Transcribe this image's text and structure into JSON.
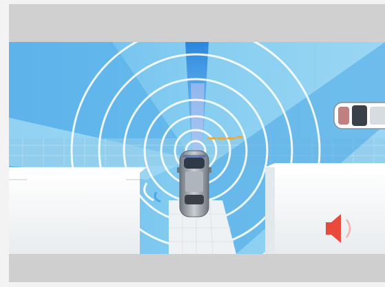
{
  "scene": {
    "description_label": "",
    "colors": {
      "sky_blue": "#7fc8ef",
      "deep_blue": "#4aa8e6",
      "beam_blue": "#2f8ee0",
      "ring_white": "#ffffff",
      "wall_white": "#f4f6f8",
      "road_light": "#e9f3f8",
      "car_gray": "#8e959d",
      "car_dark": "#3a4048",
      "orange_signal": "#f5a623",
      "speaker_red": "#e84a3c",
      "band_gray": "#d0d0d0"
    },
    "icons": {
      "sensor_waves": "concentric-rings",
      "warning_speaker": "speaker-icon",
      "parked_vehicle": "car-icon",
      "ego_vehicle": "car-icon"
    }
  }
}
